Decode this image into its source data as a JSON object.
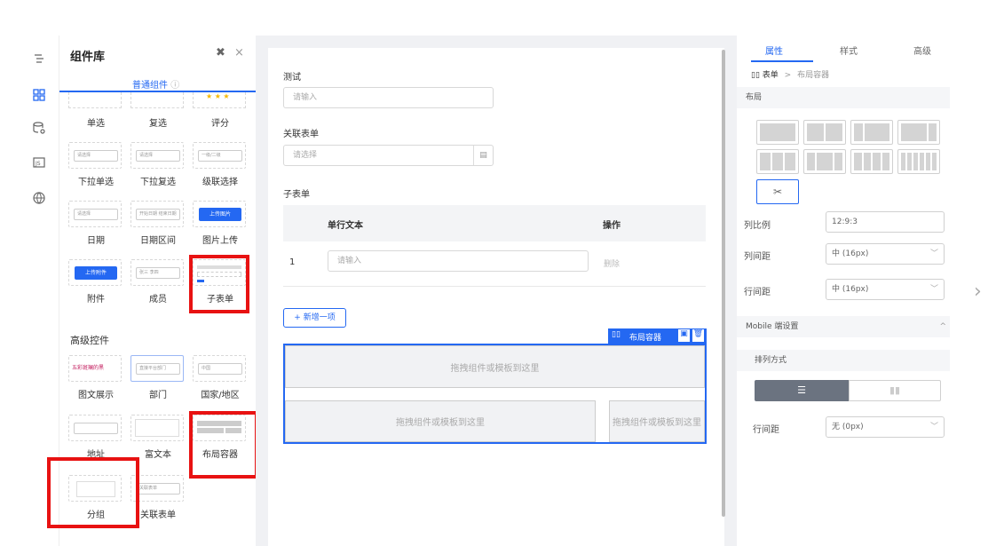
{
  "library": {
    "title": "组件库",
    "tab_label": "普通组件",
    "row1_labels": [
      "单选",
      "复选",
      "评分"
    ],
    "components": [
      {
        "label": "下拉单选",
        "thumb": "请选择"
      },
      {
        "label": "下拉复选",
        "thumb": "请选择"
      },
      {
        "label": "级联选择",
        "thumb": "一级/二级"
      },
      {
        "label": "日期",
        "thumb": "请选择"
      },
      {
        "label": "日期区间",
        "thumb": "开始日期 结束日期"
      },
      {
        "label": "图片上传",
        "thumb": "上传图片"
      },
      {
        "label": "附件",
        "thumb": "上传附件"
      },
      {
        "label": "成员",
        "thumb": "张三 李四"
      },
      {
        "label": "子表单",
        "thumb": ""
      }
    ],
    "advanced_title": "高级控件",
    "advanced": [
      {
        "label": "图文展示",
        "thumb": "五彩斑斓的黑"
      },
      {
        "label": "部门",
        "thumb": "直接平台部门"
      },
      {
        "label": "国家/地区",
        "thumb": "中国"
      },
      {
        "label": "地址",
        "thumb": ""
      },
      {
        "label": "富文本",
        "thumb": ""
      },
      {
        "label": "布局容器",
        "thumb": ""
      },
      {
        "label": "分组",
        "thumb": ""
      },
      {
        "label": "关联表单",
        "thumb": "关联表单"
      }
    ]
  },
  "canvas": {
    "field1_label": "测试",
    "field1_placeholder": "请输入",
    "field2_label": "关联表单",
    "field2_placeholder": "请选择",
    "subform_label": "子表单",
    "col_text": "单行文本",
    "col_ops": "操作",
    "row_index": "1",
    "row_placeholder": "请输入",
    "row_delete": "删除",
    "add_item": "+ 新增一项",
    "container_tag": "布局容器",
    "drop_text": "拖拽组件或模板到这里"
  },
  "props": {
    "tabs": [
      "属性",
      "样式",
      "高级"
    ],
    "breadcrumb_root": "表单",
    "breadcrumb_sep": ">",
    "breadcrumb_leaf": "布局容器",
    "layout_section": "布局",
    "col_ratio_label": "列比例",
    "col_ratio_value": "12:9:3",
    "col_gap_label": "列间距",
    "col_gap_value": "中 (16px)",
    "row_gap_label": "行间距",
    "row_gap_value": "中 (16px)",
    "mobile_section": "Mobile 端设置",
    "arrange_label": "排列方式",
    "mobile_row_gap_label": "行间距",
    "mobile_row_gap_value": "无 (0px)"
  },
  "colors": {
    "accent": "#2468f2",
    "highlight": "#e81212"
  }
}
